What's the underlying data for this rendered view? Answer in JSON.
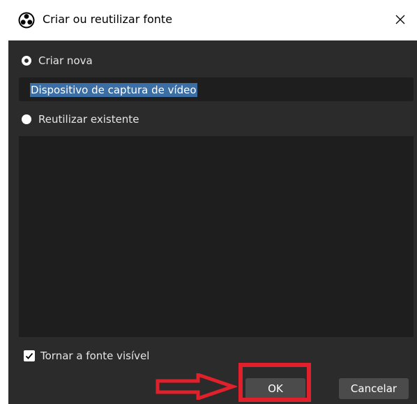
{
  "window": {
    "title": "Criar ou reutilizar fonte",
    "close_symbol": "✕"
  },
  "options": {
    "create_new_label": "Criar nova",
    "create_new_selected": true,
    "source_name_value": "Dispositivo de captura de vídeo",
    "reuse_existing_label": "Reutilizar existente",
    "reuse_existing_selected": false,
    "existing_sources": []
  },
  "visibility": {
    "label": "Tornar a fonte visível",
    "checked": true
  },
  "buttons": {
    "ok_label": "OK",
    "cancel_label": "Cancelar"
  },
  "annotation": {
    "color": "#e0202a"
  },
  "icons": {
    "app": "obs-logo-icon",
    "close": "close-icon",
    "check": "checkmark-icon",
    "arrow": "right-arrow-icon"
  }
}
